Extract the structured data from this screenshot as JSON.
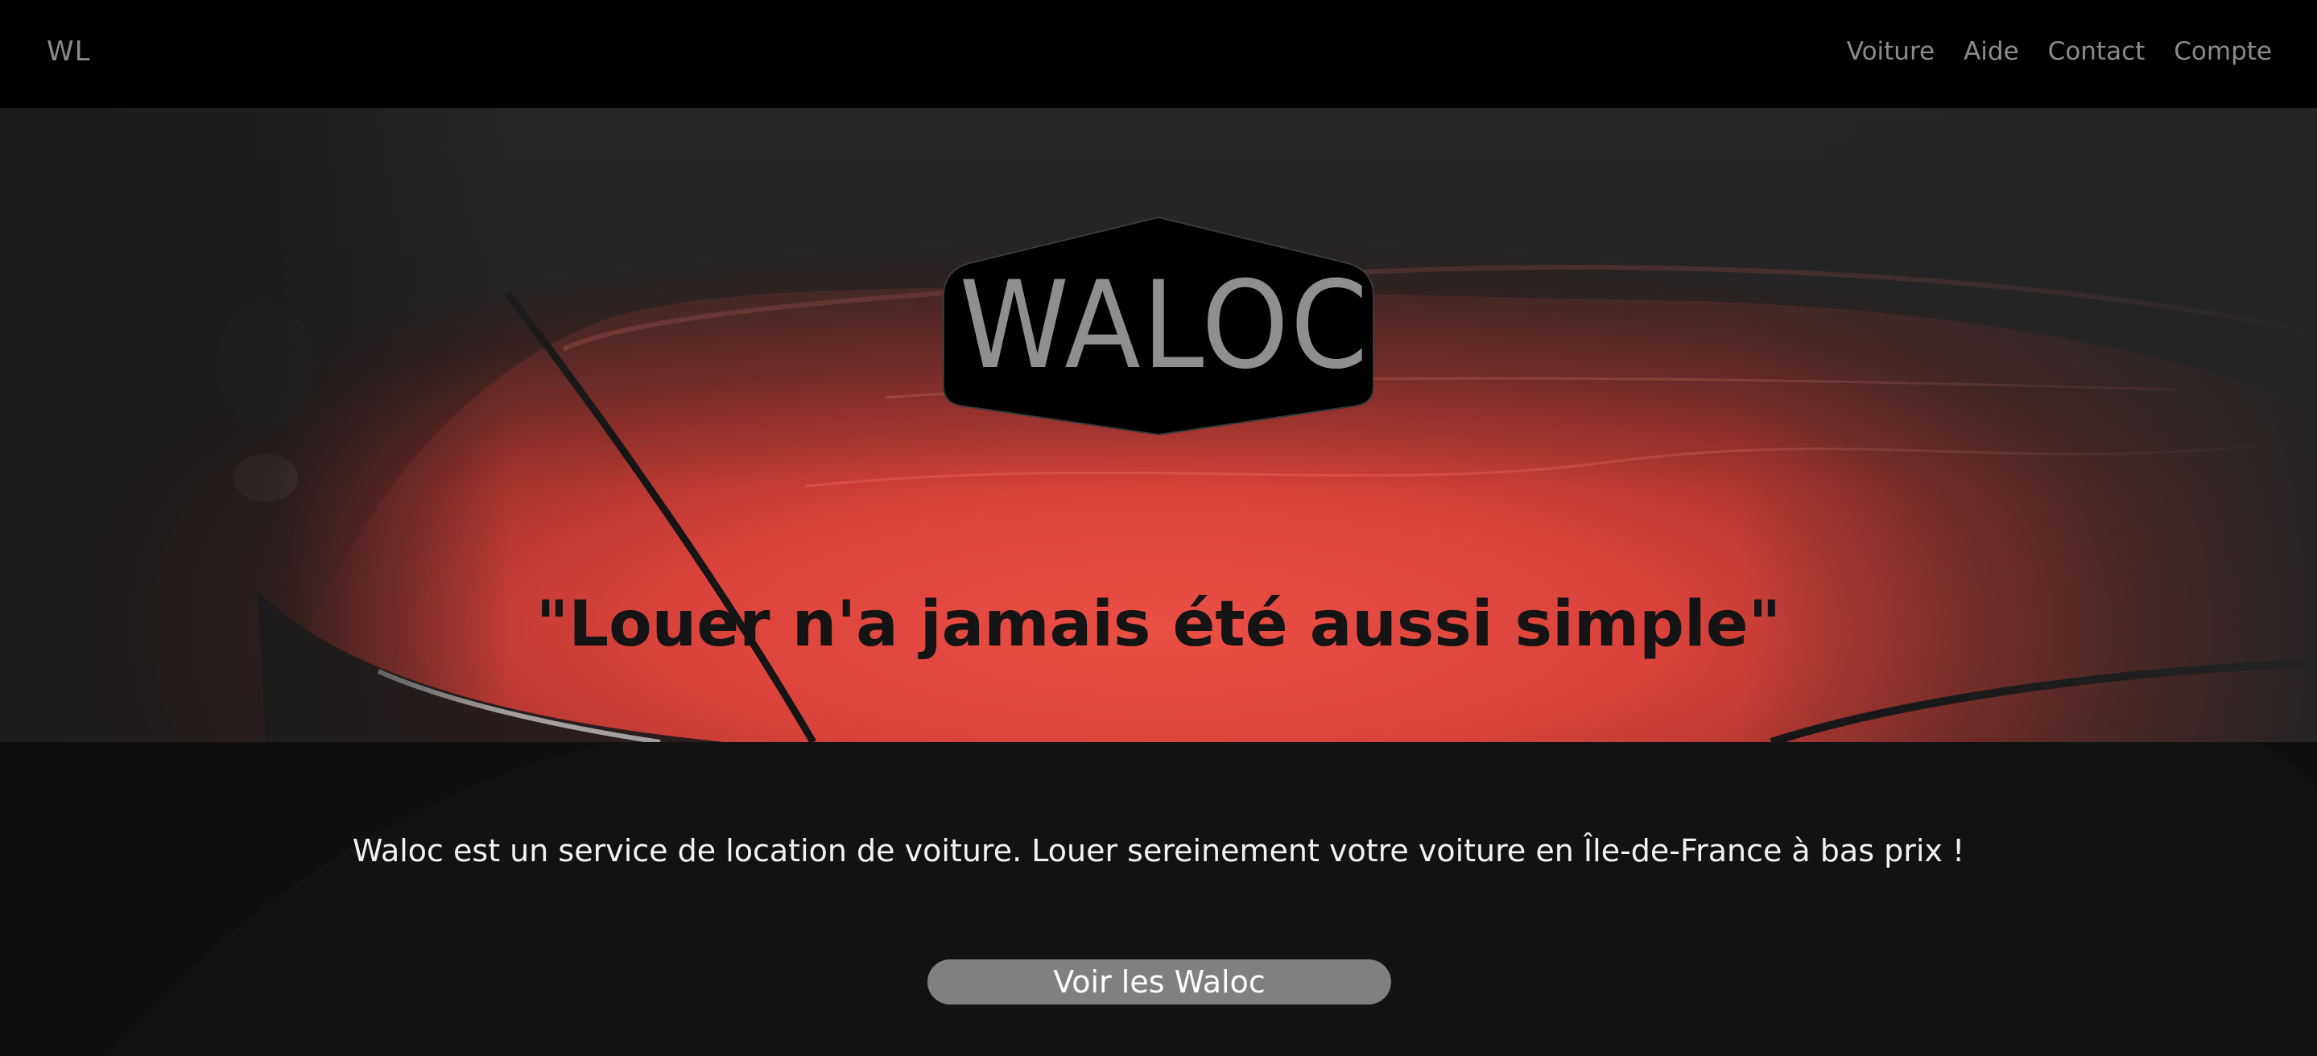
{
  "navbar": {
    "brand": "WL",
    "links": [
      "Voiture",
      "Aide",
      "Contact",
      "Compte"
    ]
  },
  "hero": {
    "logo_text": "WALOC",
    "tagline": "\"Louer n'a jamais été aussi simple\""
  },
  "info": {
    "description": "Waloc est un service de location de voiture. Louer sereinement votre voiture en Île-de-France à bas prix !",
    "button_label": "Voir les Waloc"
  },
  "colors": {
    "navbar_bg": "#000000",
    "nav_text": "#8c8c8c",
    "car_red": "#e0483f",
    "logo_bg": "#000000",
    "logo_text": "#8f8f8f",
    "info_bg": "#0f0f0f",
    "button_bg": "#808080",
    "button_text": "#ffffff"
  }
}
